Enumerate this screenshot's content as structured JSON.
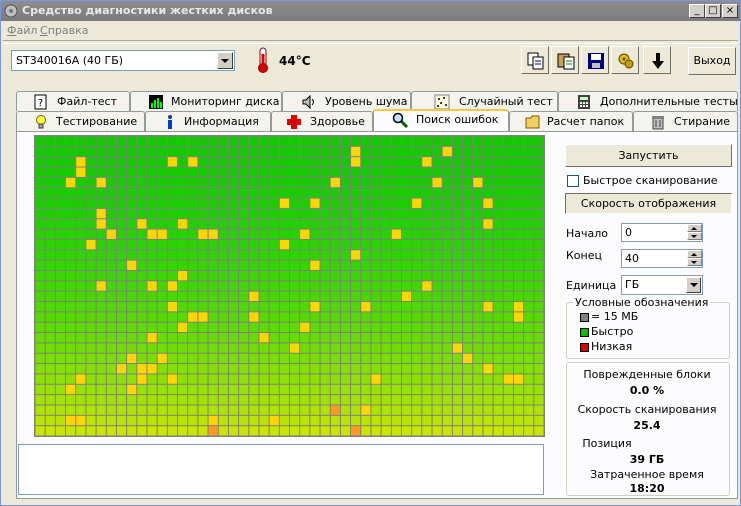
{
  "window": {
    "title": "Средство диагностики жестких дисков",
    "controls": [
      "_",
      "□",
      "×"
    ]
  },
  "menu": [
    "Файл",
    "Справка"
  ],
  "toolbar": {
    "disk_select": "ST340016A (40 ГБ)",
    "temperature": "44°C",
    "icons": [
      "copy-icon",
      "paste-icon",
      "save-icon",
      "settings-icon",
      "download-arrow-icon"
    ],
    "exit_label": "Выход"
  },
  "tabs_row1": [
    {
      "label": "Файл-тест",
      "icon": "file-test-icon"
    },
    {
      "label": "Мониторинг диска",
      "icon": "monitor-chart-icon"
    },
    {
      "label": "Уровень шума",
      "icon": "speaker-icon"
    },
    {
      "label": "Случайный тест",
      "icon": "random-test-icon"
    },
    {
      "label": "Дополнительные тесты",
      "icon": "calculator-icon"
    }
  ],
  "tabs_row2": [
    {
      "label": "Тестирование",
      "icon": "bulb-icon"
    },
    {
      "label": "Информация",
      "icon": "info-icon"
    },
    {
      "label": "Здоровье",
      "icon": "red-cross-icon"
    },
    {
      "label": "Поиск ошибок",
      "icon": "magnifier-icon",
      "active": true
    },
    {
      "label": "Расчет папок",
      "icon": "folder-icon"
    },
    {
      "label": "Стирание",
      "icon": "trash-icon"
    }
  ],
  "scan_panel": {
    "start_button": "Запустить",
    "quick_scan_label": "Быстрое сканирование",
    "quick_scan_checked": false,
    "display_speed_button": "Скорость отображения",
    "start_label": "Начало",
    "start_value": "0",
    "end_label": "Конец",
    "end_value": "40",
    "unit_label": "Единица",
    "unit_value": "ГБ"
  },
  "legend": {
    "title": "Условные обозначения",
    "items": [
      {
        "label": "= 15 МБ",
        "color": "#808080"
      },
      {
        "label": "Быстро",
        "color": "#00c000"
      },
      {
        "label": "Низкая",
        "color": "#e00000"
      }
    ]
  },
  "stats": {
    "damaged_label": "Поврежденные блоки",
    "damaged_value": "0.0 %",
    "speed_label": "Скорость сканирования",
    "speed_value": "25.4",
    "position_label": "Позиция",
    "position_value": "39 ГБ",
    "elapsed_label": "Затраченное время",
    "elapsed_value": "18:20"
  },
  "scan_grid": {
    "columns": 50,
    "rows": 29,
    "colors": {
      "fast": "#00c800",
      "slow_mark": "#ffd700",
      "grid": "#808080"
    }
  }
}
